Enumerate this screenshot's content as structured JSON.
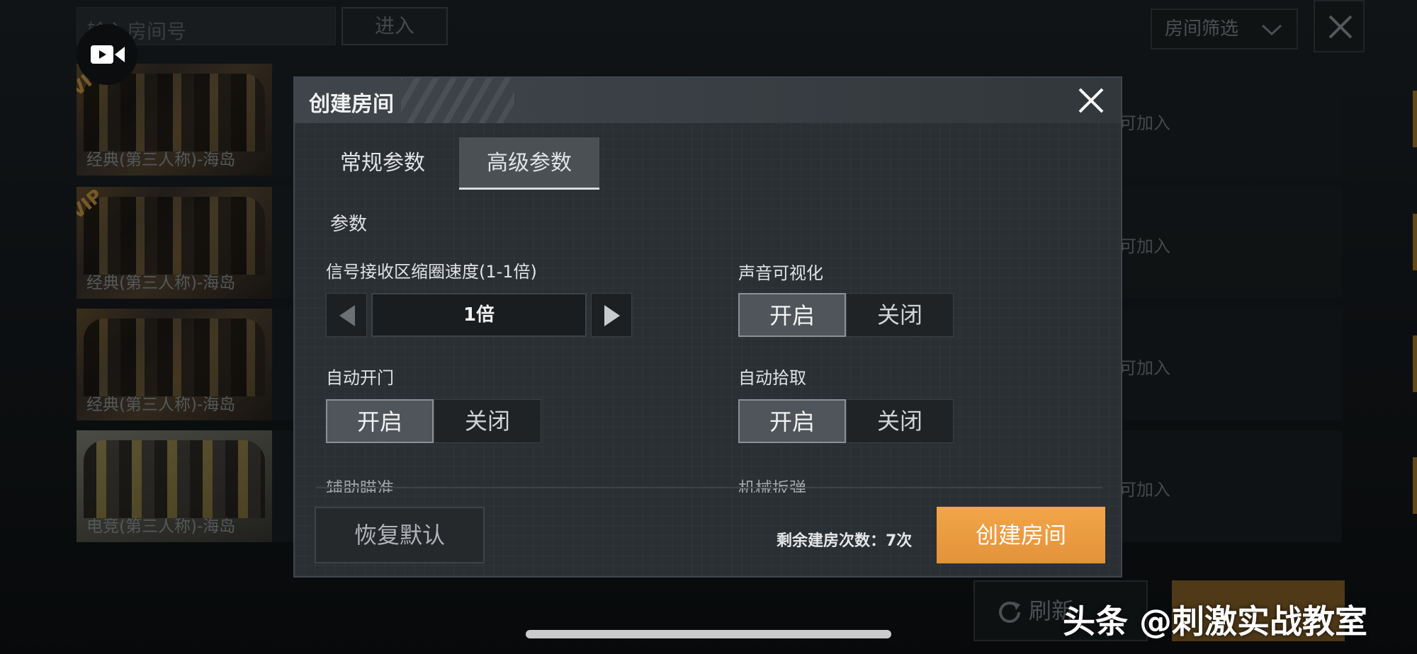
{
  "lobby": {
    "room_input_placeholder": "输入房间号",
    "enter_label": "进入",
    "filter_label": "房间筛选",
    "rooms": [
      {
        "caption": "经典(第三人称)-海岛",
        "status": "可加入",
        "vip": "VIP"
      },
      {
        "caption": "经典(第三人称)-海岛",
        "status": "可加入",
        "vip": "VIP"
      },
      {
        "caption": "经典(第三人称)-海岛",
        "status": "可加入",
        "vip": ""
      },
      {
        "caption": "电竞(第三人称)-海岛",
        "status": "可加入",
        "vip": ""
      }
    ],
    "refresh_label": "刷新",
    "accent_color": "#c78b33"
  },
  "modal": {
    "title": "创建房间",
    "tabs": [
      {
        "label": "常规参数",
        "active": false
      },
      {
        "label": "高级参数",
        "active": true
      }
    ],
    "section_label": "参数",
    "params": {
      "shrink_speed": {
        "label": "信号接收区缩圈速度(1-1倍)",
        "value": "1倍"
      },
      "sound_visual": {
        "label": "声音可视化",
        "on": "开启",
        "off": "关闭",
        "selected": "开启"
      },
      "auto_door": {
        "label": "自动开门",
        "on": "开启",
        "off": "关闭",
        "selected": "开启"
      },
      "auto_pickup": {
        "label": "自动拾取",
        "on": "开启",
        "off": "关闭",
        "selected": "开启"
      },
      "aim_assist": {
        "label": "辅助瞄准"
      },
      "mech_reload": {
        "label": "机械扳弹"
      }
    },
    "restore_label": "恢复默认",
    "remaining_text": "剩余建房次数：7次",
    "create_label": "创建房间",
    "create_color": "#e89a3e"
  },
  "watermark": "头条 @刺激实战教室"
}
